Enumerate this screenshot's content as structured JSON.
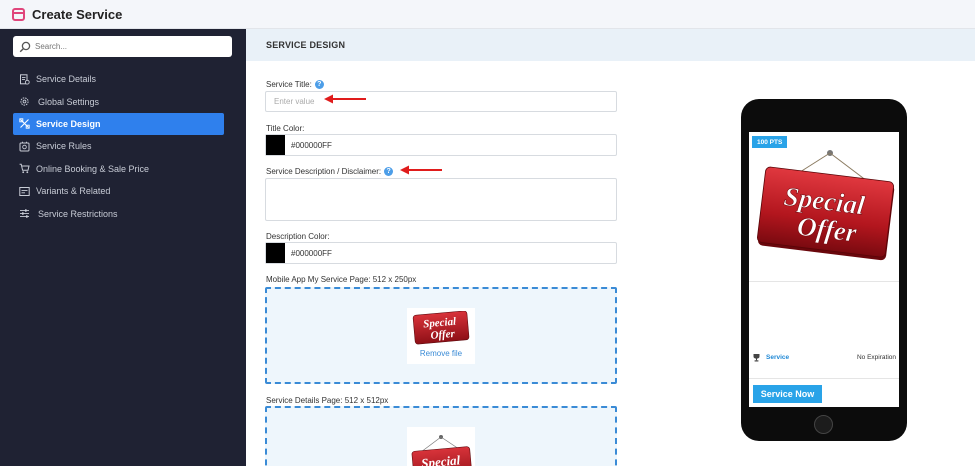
{
  "app": {
    "title": "Create Service",
    "icon": "calendar-icon",
    "accent": "#e0457b"
  },
  "search": {
    "placeholder": "Search..."
  },
  "sidebar": {
    "items": [
      {
        "label": "Service Details",
        "icon": "document-settings-icon",
        "active": false
      },
      {
        "label": "Global Settings",
        "icon": "gear-icon",
        "active": false
      },
      {
        "label": "Service Design",
        "icon": "design-tools-icon",
        "active": true
      },
      {
        "label": "Service Rules",
        "icon": "rules-icon",
        "active": false
      },
      {
        "label": "Online Booking & Sale Price",
        "icon": "cart-icon",
        "active": false
      },
      {
        "label": "Variants & Related",
        "icon": "variants-icon",
        "active": false
      },
      {
        "label": "Service Restrictions",
        "icon": "sliders-icon",
        "active": false
      }
    ],
    "active_color": "#2f80ed",
    "background": "#1f2233"
  },
  "section": {
    "title": "SERVICE DESIGN"
  },
  "form": {
    "title_label": "Service Title:",
    "title_placeholder": "Enter value",
    "title_value": "",
    "title_color_label": "Title Color:",
    "title_color_value": "#000000FF",
    "description_label": "Service Description / Disclaimer:",
    "description_value": "",
    "description_color_label": "Description Color:",
    "description_color_value": "#000000FF",
    "mobile_image_label": "Mobile App My Service Page: 512 x 250px",
    "remove_file_label": "Remove file",
    "details_image_label": "Service Details Page: 512 x 512px"
  },
  "preview": {
    "points_badge": "100 PTS",
    "sign_line1": "Special",
    "sign_line2": "Offer",
    "service_link": "Service",
    "expiration": "No Expiration",
    "button_label": "Service Now",
    "button_color": "#29a3e8"
  }
}
